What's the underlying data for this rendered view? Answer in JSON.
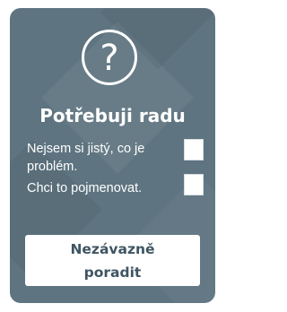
{
  "widget": {
    "icon": "question-mark-circle-icon",
    "icon_glyph": "?",
    "title": "Potřebuji radu",
    "options": [
      {
        "label": "Nejsem si jistý, co je problém.",
        "checked": false
      },
      {
        "label": "Chci to pojmenovat.",
        "checked": false
      }
    ],
    "cta_label": "Nezávazně poradit",
    "colors": {
      "card_background": "#5e7480",
      "text": "#ffffff",
      "cta_background": "#ffffff",
      "cta_text": "#3f5562"
    }
  }
}
